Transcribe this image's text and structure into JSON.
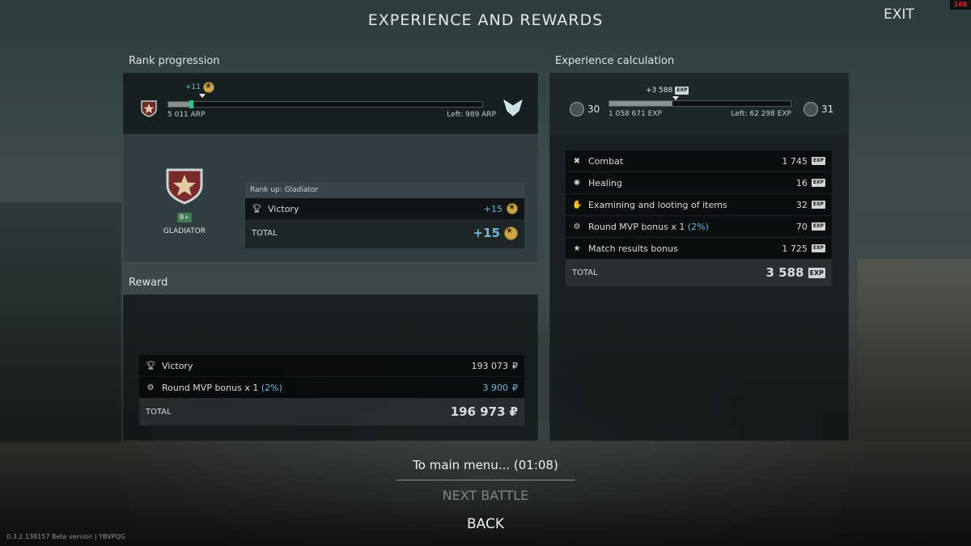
{
  "title": "EXPERIENCE AND REWARDS",
  "exit_label": "EXIT",
  "corner_badge": "168",
  "rank": {
    "section_label": "Rank progression",
    "gain_text": "+11",
    "current_text": "5 011 ARP",
    "left_text": "Left: 989 ARP",
    "progress": 0.08,
    "rank_badge": "B+",
    "rank_name": "GLADIATOR",
    "rankup_title": "Rank up: Gladiator",
    "rows": [
      {
        "label": "Victory",
        "value": "+15"
      }
    ],
    "total_label": "TOTAL",
    "total_value": "+15"
  },
  "experience": {
    "section_label": "Experience calculation",
    "gain_text": "+3 588",
    "level_current": "30",
    "level_next": "31",
    "current_text": "1 058 671 EXP",
    "left_text": "Left: 62 298 EXP",
    "progress": 0.35,
    "rows": [
      {
        "icon": "combat-icon",
        "label": "Combat",
        "extra": "",
        "value": "1 745"
      },
      {
        "icon": "healing-icon",
        "label": "Healing",
        "extra": "",
        "value": "16"
      },
      {
        "icon": "looting-icon",
        "label": "Examining and looting of items",
        "extra": "",
        "value": "32"
      },
      {
        "icon": "mvp-icon",
        "label": "Round MVP bonus x 1",
        "extra": "(2%)",
        "value": "70"
      },
      {
        "icon": "star-icon",
        "label": "Match results bonus",
        "extra": "",
        "value": "1 725"
      }
    ],
    "exp_badge": "EXP",
    "total_label": "TOTAL",
    "total_value": "3 588"
  },
  "reward": {
    "section_label": "Reward",
    "rows": [
      {
        "label": "Victory",
        "extra": "",
        "value": "193 073"
      },
      {
        "label": "Round MVP bonus x 1",
        "extra": "(2%)",
        "value": "3 900"
      }
    ],
    "currency": "₽",
    "total_label": "TOTAL",
    "total_value": "196 973"
  },
  "buttons": {
    "main_menu": "To main menu... (01:08)",
    "next_battle": "NEXT BATTLE",
    "back": "BACK"
  },
  "version_text": "0.3.2.138157 Beta version | YBVPQG"
}
